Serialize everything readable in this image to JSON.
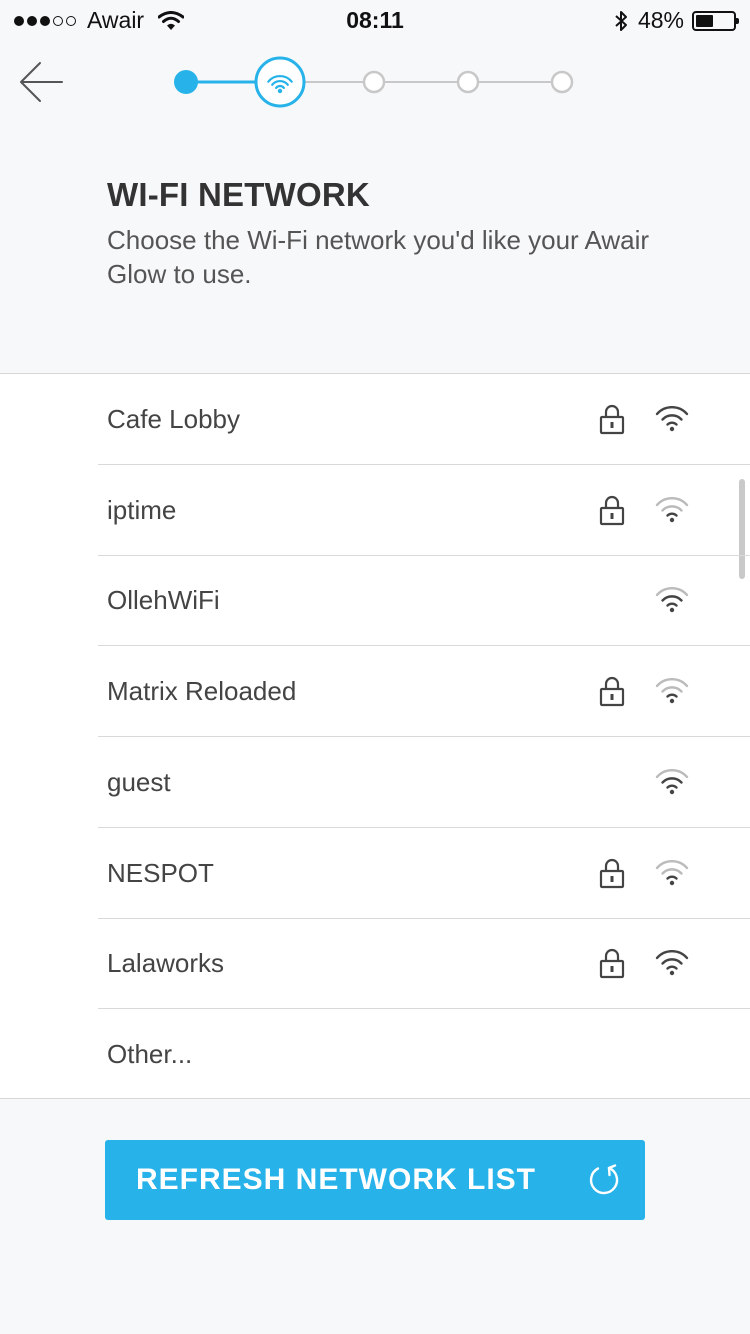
{
  "status_bar": {
    "carrier": "Awair",
    "time": "08:11",
    "battery_text": "48%",
    "battery_level": 0.48,
    "signal_bars_filled": 3,
    "signal_bars_total": 5
  },
  "setup": {
    "total_steps": 5,
    "current_step": 2
  },
  "header": {
    "title": "WI-FI NETWORK",
    "subtitle": "Choose the Wi-Fi network you'd like your Awair Glow to use."
  },
  "networks": [
    {
      "name": "Cafe Lobby",
      "secured": true,
      "signal": "strong"
    },
    {
      "name": "iptime",
      "secured": true,
      "signal": "weak"
    },
    {
      "name": "OllehWiFi",
      "secured": false,
      "signal": "medium"
    },
    {
      "name": "Matrix Reloaded",
      "secured": true,
      "signal": "weak"
    },
    {
      "name": "guest",
      "secured": false,
      "signal": "medium"
    },
    {
      "name": "NESPOT",
      "secured": true,
      "signal": "weak"
    },
    {
      "name": "Lalaworks",
      "secured": true,
      "signal": "strong"
    },
    {
      "name": "Other...",
      "secured": false,
      "signal": "none"
    }
  ],
  "refresh_button": {
    "label": "REFRESH NETWORK LIST"
  },
  "colors": {
    "accent": "#27b3e9",
    "inactive_step": "#c8c8c8",
    "page_background": "#f7f8fa",
    "text_primary": "#333333"
  },
  "icons": {
    "back": "arrow-left-icon",
    "wifi": "wifi-icon",
    "lock": "lock-icon",
    "refresh": "refresh-icon",
    "bluetooth": "bluetooth-icon"
  }
}
